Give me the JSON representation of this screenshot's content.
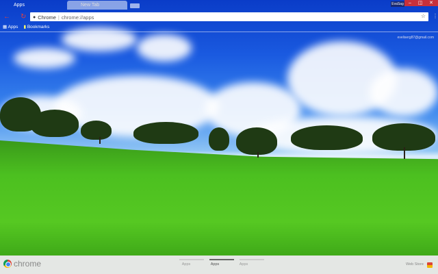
{
  "tabs": [
    {
      "label": "Apps"
    },
    {
      "label": "New Tab"
    }
  ],
  "profile": "EvaSag",
  "window_controls": {
    "minimize": "–",
    "maximize": "◫",
    "close": "✕"
  },
  "omnibox": {
    "site": "Chrome",
    "separator": "|",
    "url": "chrome://apps"
  },
  "bookmarks": [
    {
      "label": "Apps"
    },
    {
      "label": "Bookmarks"
    }
  ],
  "account_email": "eveliserg87@gmail.com",
  "footer": {
    "brand": "chrome",
    "pages": [
      "Apps",
      "Apps",
      "Apps"
    ],
    "active_page": 1,
    "webstore": "Web Store"
  }
}
